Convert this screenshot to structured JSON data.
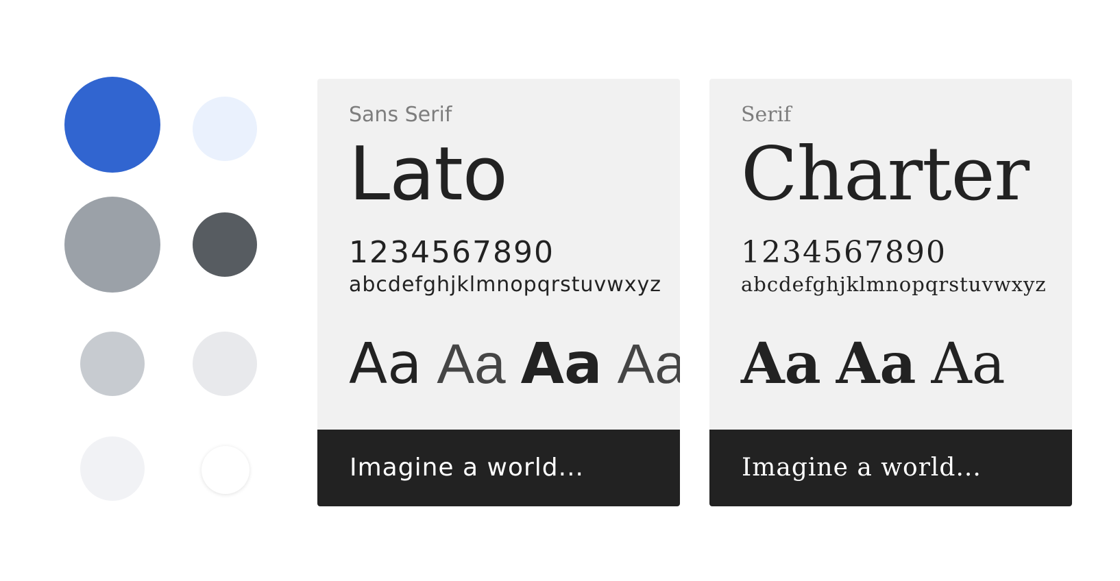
{
  "palette": {
    "swatches": [
      {
        "name": "primary-blue",
        "color": "#3165d0"
      },
      {
        "name": "light-blue",
        "color": "#eaf1fd"
      },
      {
        "name": "mid-gray",
        "color": "#9ba1a8"
      },
      {
        "name": "dark-gray",
        "color": "#575c61"
      },
      {
        "name": "light-gray",
        "color": "#c7cbd0"
      },
      {
        "name": "pale-gray",
        "color": "#e8e9ec"
      },
      {
        "name": "off-white",
        "color": "#f1f2f5"
      },
      {
        "name": "white",
        "color": "#ffffff"
      }
    ]
  },
  "cards": [
    {
      "label": "Sans Serif",
      "family": "Lato",
      "numerals": "1234567890",
      "alphabet": "abcdefghjklmnopqrstuvwxyz",
      "samples": [
        "Aa",
        "Aa",
        "Aa",
        "Aa"
      ],
      "footer": "Imagine a world..."
    },
    {
      "label": "Serif",
      "family": "Charter",
      "numerals": "1234567890",
      "alphabet": "abcdefghjklmnopqrstuvwxyz",
      "samples": [
        "Aa",
        "Aa",
        "Aa"
      ],
      "footer": "Imagine a world..."
    }
  ]
}
